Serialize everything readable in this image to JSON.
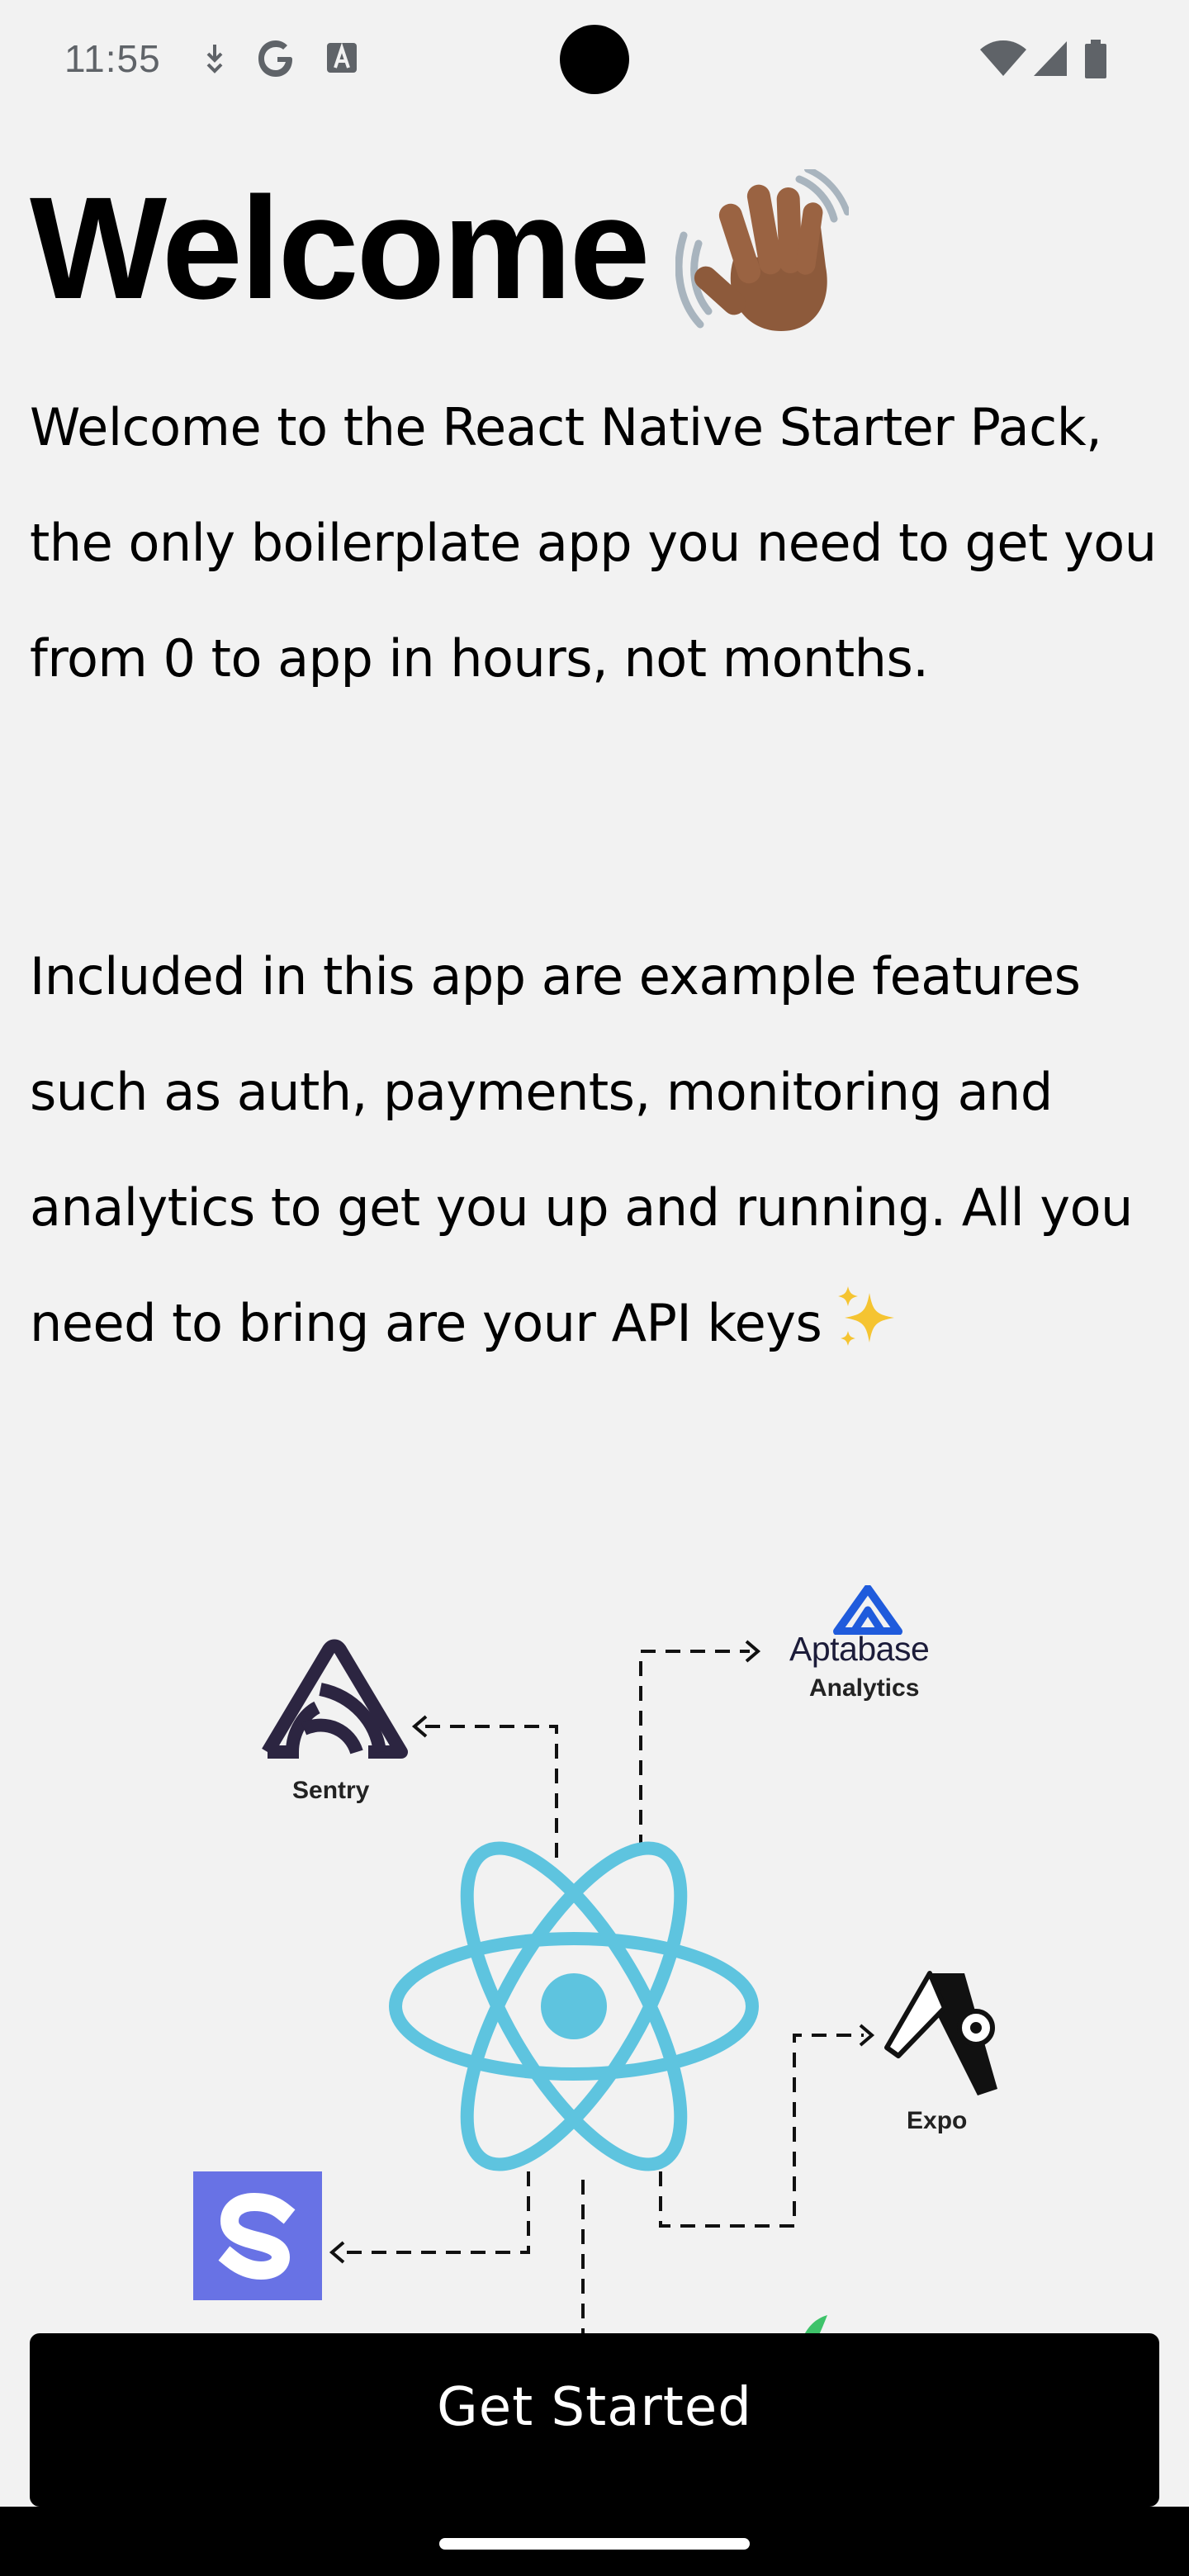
{
  "status_bar": {
    "time": "11:55",
    "icons": [
      "download-notification-icon",
      "google-icon",
      "font-a-icon",
      "wifi-icon",
      "cellular-signal-icon",
      "battery-icon"
    ]
  },
  "welcome": {
    "title": "Welcome",
    "title_emoji": "waving-hand-icon",
    "intro": "Welcome to the React Native Starter Pack, the only boilerplate app you need to get you from 0 to app in hours, not months.",
    "features": "Included in this app are example features such as auth, payments, monitoring and analytics to get you up and running. All you need to bring are your API keys",
    "features_emoji": "sparkles-icon"
  },
  "diagram": {
    "center": "react-logo-icon",
    "nodes": {
      "sentry": "Sentry",
      "aptabase_name": "Aptabase",
      "aptabase_sub": "Analytics",
      "expo": "Expo"
    },
    "icons": [
      "sentry-logo-icon",
      "aptabase-logo-icon",
      "expo-logo-icon",
      "stripe-logo-icon"
    ]
  },
  "actions": {
    "get_started_label": "Get Started"
  },
  "colors": {
    "background": "#f2f2f2",
    "button": "#000000",
    "react": "#5ec4df",
    "stripe": "#6872e5",
    "aptabase": "#1f5bdc",
    "sentry": "#2c2541"
  }
}
